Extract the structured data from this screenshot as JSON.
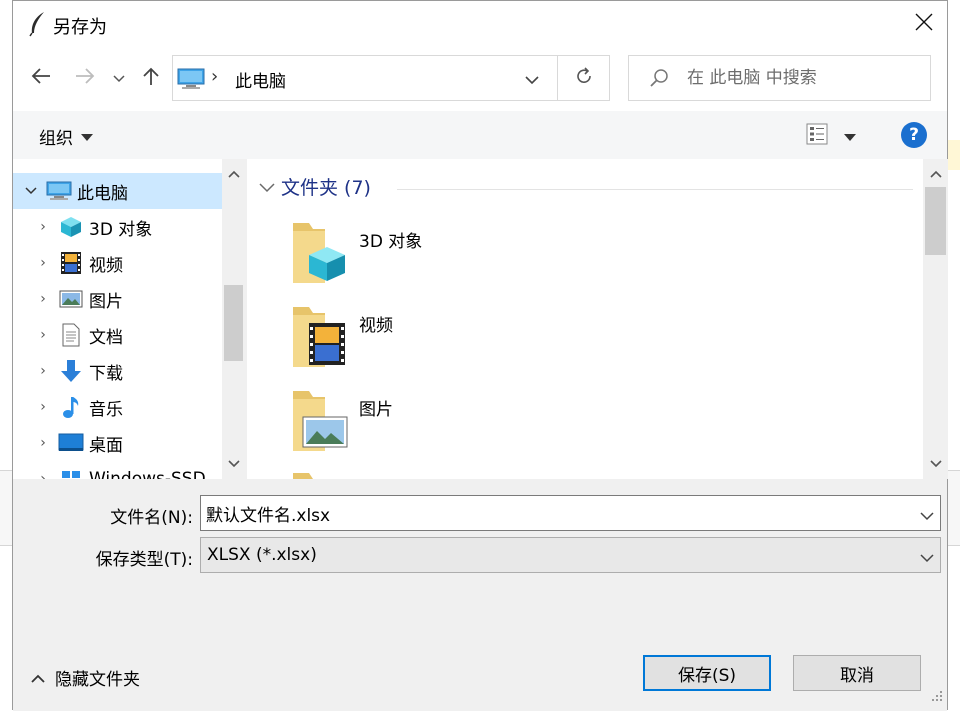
{
  "dialog": {
    "title": "另存为"
  },
  "address": {
    "crumb": "此电脑"
  },
  "search": {
    "placeholder": "在 此电脑 中搜索"
  },
  "toolbar": {
    "organize_label": "组织"
  },
  "nav": {
    "items": [
      {
        "label": "此电脑",
        "icon": "computer-icon",
        "selected": true,
        "expanded": true
      },
      {
        "label": "3D 对象",
        "icon": "3d-objects-icon"
      },
      {
        "label": "视频",
        "icon": "video-icon"
      },
      {
        "label": "图片",
        "icon": "pictures-icon"
      },
      {
        "label": "文档",
        "icon": "documents-icon"
      },
      {
        "label": "下载",
        "icon": "download-icon"
      },
      {
        "label": "音乐",
        "icon": "music-icon"
      },
      {
        "label": "桌面",
        "icon": "desktop-icon"
      },
      {
        "label": "Windows-SSD",
        "icon": "drive-icon"
      }
    ]
  },
  "content": {
    "group_header": "文件夹 (7)",
    "folders": [
      {
        "name": "3D 对象",
        "icon": "3d-objects-folder-icon"
      },
      {
        "name": "视频",
        "icon": "video-folder-icon"
      },
      {
        "name": "图片",
        "icon": "pictures-folder-icon"
      }
    ]
  },
  "form": {
    "filename_label": "文件名(N):",
    "filename_value": "默认文件名.xlsx",
    "filetype_label": "保存类型(T):",
    "filetype_value": "XLSX (*.xlsx)"
  },
  "footer": {
    "hide_folders_label": "隐藏文件夹",
    "save_label": "保存(S)",
    "cancel_label": "取消"
  },
  "colors": {
    "accent": "#0078d7",
    "selection": "#cce8ff",
    "group_header": "#1e3287"
  }
}
